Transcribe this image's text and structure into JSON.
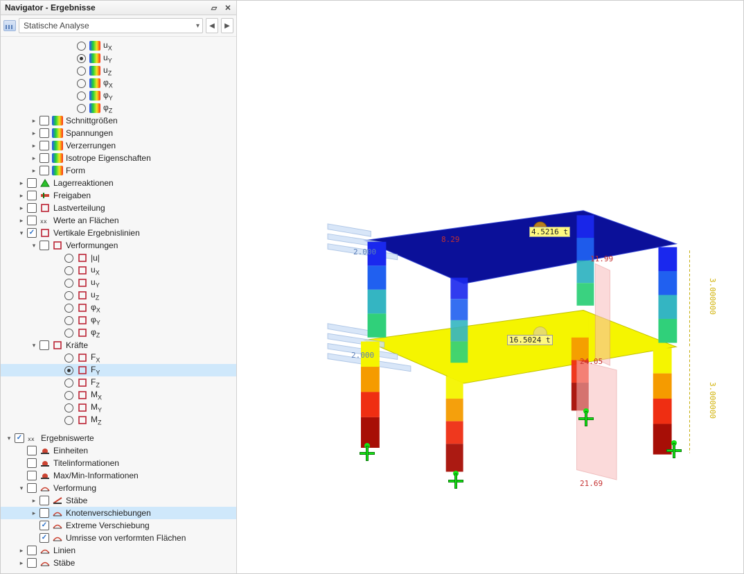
{
  "panel": {
    "title": "Navigator - Ergebnisse",
    "dropdown_value": "Statische Analyse",
    "tree": [
      {
        "id": "ux",
        "depth": 4,
        "exp": null,
        "chk": null,
        "radio": "off",
        "icon": "heat",
        "label": "u",
        "sub": "X"
      },
      {
        "id": "uy",
        "depth": 4,
        "exp": null,
        "chk": null,
        "radio": "on",
        "icon": "heat",
        "label": "u",
        "sub": "Y"
      },
      {
        "id": "uz",
        "depth": 4,
        "exp": null,
        "chk": null,
        "radio": "off",
        "icon": "heat",
        "label": "u",
        "sub": "Z"
      },
      {
        "id": "phix",
        "depth": 4,
        "exp": null,
        "chk": null,
        "radio": "off",
        "icon": "heat",
        "label": "φ",
        "sub": "X"
      },
      {
        "id": "phiy",
        "depth": 4,
        "exp": null,
        "chk": null,
        "radio": "off",
        "icon": "heat",
        "label": "φ",
        "sub": "Y"
      },
      {
        "id": "phiz",
        "depth": 4,
        "exp": null,
        "chk": null,
        "radio": "off",
        "icon": "heat",
        "label": "φ",
        "sub": "Z"
      },
      {
        "id": "schnitt",
        "depth": 2,
        "exp": "closed",
        "chk": "off",
        "radio": null,
        "icon": "heat",
        "label": "Schnittgrößen"
      },
      {
        "id": "spann",
        "depth": 2,
        "exp": "closed",
        "chk": "off",
        "radio": null,
        "icon": "heat",
        "label": "Spannungen"
      },
      {
        "id": "verzerr",
        "depth": 2,
        "exp": "closed",
        "chk": "off",
        "radio": null,
        "icon": "heat",
        "label": "Verzerrungen"
      },
      {
        "id": "iso",
        "depth": 2,
        "exp": "closed",
        "chk": "off",
        "radio": null,
        "icon": "heat",
        "label": "Isotrope Eigenschaften"
      },
      {
        "id": "form",
        "depth": 2,
        "exp": "closed",
        "chk": "off",
        "radio": null,
        "icon": "heat",
        "label": "Form"
      },
      {
        "id": "lager",
        "depth": 1,
        "exp": "closed",
        "chk": "off",
        "radio": null,
        "icon": "lager",
        "label": "Lagerreaktionen"
      },
      {
        "id": "frei",
        "depth": 1,
        "exp": "closed",
        "chk": "off",
        "radio": null,
        "icon": "frei",
        "label": "Freigaben"
      },
      {
        "id": "last",
        "depth": 1,
        "exp": "closed",
        "chk": "off",
        "radio": null,
        "icon": "last",
        "label": "Lastverteilung"
      },
      {
        "id": "werte",
        "depth": 1,
        "exp": "closed",
        "chk": "off",
        "radio": null,
        "icon": "fla",
        "label": "Werte an Flächen"
      },
      {
        "id": "vert",
        "depth": 1,
        "exp": "open",
        "chk": "on",
        "radio": null,
        "icon": "sec",
        "label": "Vertikale Ergebnislinien"
      },
      {
        "id": "verform",
        "depth": 2,
        "exp": "open",
        "chk": "off",
        "radio": null,
        "icon": "sec",
        "label": "Verformungen"
      },
      {
        "id": "uu",
        "depth": 3,
        "exp": null,
        "chk": null,
        "radio": "off",
        "icon": "sec",
        "label": "|u|"
      },
      {
        "id": "uux",
        "depth": 3,
        "exp": null,
        "chk": null,
        "radio": "off",
        "icon": "sec",
        "label": "u",
        "sub": "X"
      },
      {
        "id": "uuy",
        "depth": 3,
        "exp": null,
        "chk": null,
        "radio": "off",
        "icon": "sec",
        "label": "u",
        "sub": "Y"
      },
      {
        "id": "uuz",
        "depth": 3,
        "exp": null,
        "chk": null,
        "radio": "off",
        "icon": "sec",
        "label": "u",
        "sub": "Z"
      },
      {
        "id": "pphix",
        "depth": 3,
        "exp": null,
        "chk": null,
        "radio": "off",
        "icon": "sec",
        "label": "φ",
        "sub": "X"
      },
      {
        "id": "pphiy",
        "depth": 3,
        "exp": null,
        "chk": null,
        "radio": "off",
        "icon": "sec",
        "label": "φ",
        "sub": "Y"
      },
      {
        "id": "pphiz",
        "depth": 3,
        "exp": null,
        "chk": null,
        "radio": "off",
        "icon": "sec",
        "label": "φ",
        "sub": "Z"
      },
      {
        "id": "kraefte",
        "depth": 2,
        "exp": "open",
        "chk": "off",
        "radio": null,
        "icon": "sec",
        "label": "Kräfte"
      },
      {
        "id": "fx",
        "depth": 3,
        "exp": null,
        "chk": null,
        "radio": "off",
        "icon": "sec",
        "label": "F",
        "sub": "X"
      },
      {
        "id": "fy",
        "depth": 3,
        "exp": null,
        "chk": null,
        "radio": "on",
        "icon": "sec",
        "label": "F",
        "sub": "Y",
        "sel": true
      },
      {
        "id": "fz",
        "depth": 3,
        "exp": null,
        "chk": null,
        "radio": "off",
        "icon": "sec",
        "label": "F",
        "sub": "Z"
      },
      {
        "id": "mx",
        "depth": 3,
        "exp": null,
        "chk": null,
        "radio": "off",
        "icon": "sec",
        "label": "M",
        "sub": "X"
      },
      {
        "id": "my",
        "depth": 3,
        "exp": null,
        "chk": null,
        "radio": "off",
        "icon": "sec",
        "label": "M",
        "sub": "Y"
      },
      {
        "id": "mz",
        "depth": 3,
        "exp": null,
        "chk": null,
        "radio": "off",
        "icon": "sec",
        "label": "M",
        "sub": "Z"
      },
      {
        "id": "gap0",
        "depth": 0,
        "gap": true
      },
      {
        "id": "ergw",
        "depth": 0,
        "exp": "open",
        "chk": "on",
        "radio": null,
        "icon": "fla",
        "label": "Ergebniswerte"
      },
      {
        "id": "ein",
        "depth": 1,
        "exp": null,
        "chk": "off",
        "radio": null,
        "icon": "units",
        "label": "Einheiten"
      },
      {
        "id": "titel",
        "depth": 1,
        "exp": null,
        "chk": "off",
        "radio": null,
        "icon": "title",
        "label": "Titelinformationen"
      },
      {
        "id": "maxmin",
        "depth": 1,
        "exp": null,
        "chk": "off",
        "radio": null,
        "icon": "minmax",
        "label": "Max/Min-Informationen"
      },
      {
        "id": "ergverf",
        "depth": 1,
        "exp": "open",
        "chk": "off",
        "radio": null,
        "icon": "def",
        "label": "Verformung"
      },
      {
        "id": "staebe1",
        "depth": 2,
        "exp": "closed",
        "chk": "off",
        "radio": null,
        "icon": "memb",
        "label": "Stäbe"
      },
      {
        "id": "knoten",
        "depth": 2,
        "exp": "closed",
        "chk": "off",
        "radio": null,
        "icon": "def",
        "label": "Knotenverschiebungen",
        "sel": true
      },
      {
        "id": "extrv",
        "depth": 2,
        "exp": null,
        "chk": "on",
        "radio": null,
        "icon": "def",
        "label": "Extreme Verschiebung"
      },
      {
        "id": "umriss",
        "depth": 2,
        "exp": null,
        "chk": "on",
        "radio": null,
        "icon": "def",
        "label": "Umrisse von verformten Flächen"
      },
      {
        "id": "linien",
        "depth": 1,
        "exp": "closed",
        "chk": "off",
        "radio": null,
        "icon": "def",
        "label": "Linien"
      },
      {
        "id": "staebe2",
        "depth": 1,
        "exp": "closed",
        "chk": "off",
        "radio": null,
        "icon": "def",
        "label": "Stäbe"
      }
    ]
  },
  "viewport": {
    "annotations": {
      "a1": "8.29",
      "a2": "4.5216 t",
      "a3": "2.000",
      "a4": "11.99",
      "a5": "16.5024 t",
      "a6": "2.000",
      "a7": "24.05",
      "a8": "21.69",
      "dim_upper": "3.000000",
      "dim_lower": "3.000000"
    }
  }
}
